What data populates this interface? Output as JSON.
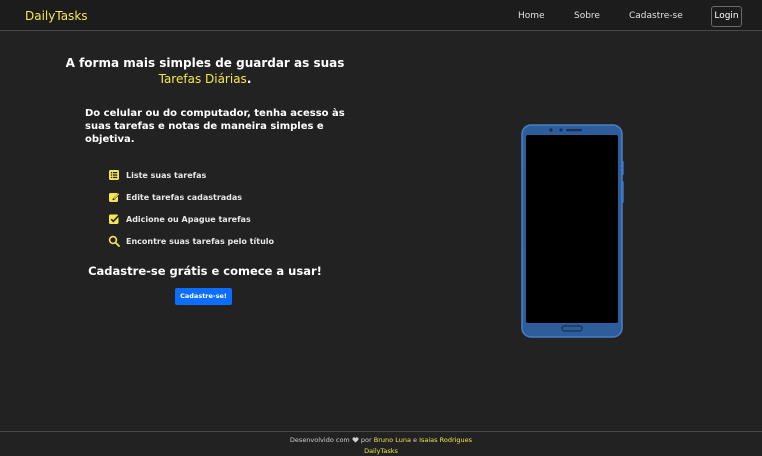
{
  "navbar": {
    "brand": "DailyTasks",
    "links": [
      "Home",
      "Sobre",
      "Cadastre-se"
    ],
    "login": "Login"
  },
  "hero": {
    "title_line1": "A forma mais simples de guardar as suas",
    "title_highlight": "Tarefas Diárias",
    "title_end": ".",
    "description": "Do celular ou do computador, tenha acesso às suas tarefas e notas de maneira simples e objetiva."
  },
  "features": [
    {
      "icon": "list-icon",
      "label": "Liste suas tarefas"
    },
    {
      "icon": "edit-icon",
      "label": "Edite tarefas cadastradas"
    },
    {
      "icon": "checkbox-icon",
      "label": "Adicione ou Apague tarefas"
    },
    {
      "icon": "search-icon",
      "label": "Encontre suas tarefas pelo título"
    }
  ],
  "cta": {
    "title": "Cadastre-se grátis e comece a usar!",
    "button": "Cadastre-se!"
  },
  "footer": {
    "prefix": "Desenvolvido com",
    "heart_icon": "heart-icon",
    "by": "por",
    "author1": "Bruno Luna",
    "and": "e",
    "author2": "Isaias Rodrigues",
    "brand": "DailyTasks"
  },
  "colors": {
    "background": "#222222",
    "navbar": "#1c1c1c",
    "accent": "#f3e84f",
    "button": "#0d6efd",
    "phone_frame": "#2e5d9c"
  }
}
